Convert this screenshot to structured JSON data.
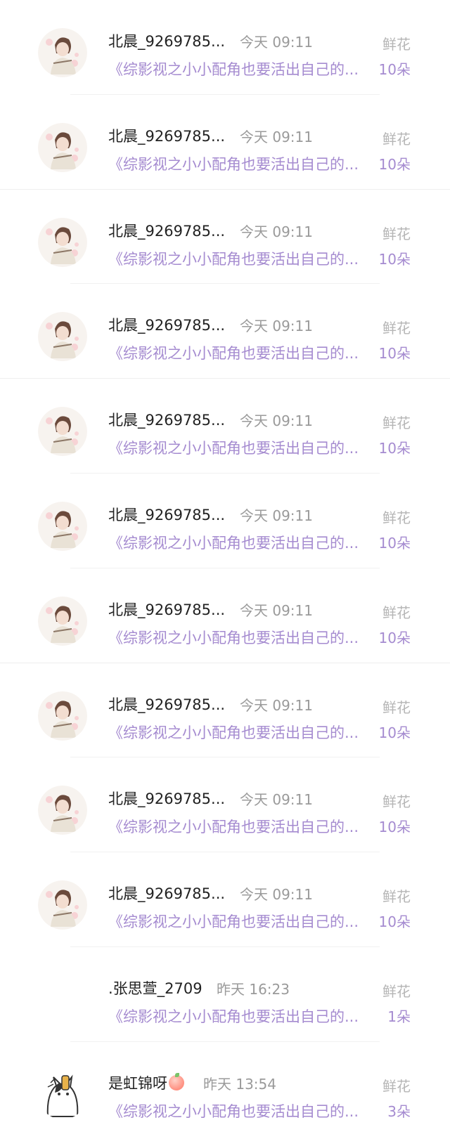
{
  "rows": [
    {
      "name": "北晨_9269785...",
      "time": "今天 09:11",
      "gift": "鲜花",
      "book": "《综影视之小小配角也要活出自己的...",
      "count": "10朵",
      "avatar": "girl-avatar"
    },
    {
      "name": "北晨_9269785...",
      "time": "今天 09:11",
      "gift": "鲜花",
      "book": "《综影视之小小配角也要活出自己的...",
      "count": "10朵",
      "avatar": "girl-avatar"
    },
    {
      "name": "北晨_9269785...",
      "time": "今天 09:11",
      "gift": "鲜花",
      "book": "《综影视之小小配角也要活出自己的...",
      "count": "10朵",
      "avatar": "girl-avatar"
    },
    {
      "name": "北晨_9269785...",
      "time": "今天 09:11",
      "gift": "鲜花",
      "book": "《综影视之小小配角也要活出自己的...",
      "count": "10朵",
      "avatar": "girl-avatar"
    },
    {
      "name": "北晨_9269785...",
      "time": "今天 09:11",
      "gift": "鲜花",
      "book": "《综影视之小小配角也要活出自己的...",
      "count": "10朵",
      "avatar": "girl-avatar"
    },
    {
      "name": "北晨_9269785...",
      "time": "今天 09:11",
      "gift": "鲜花",
      "book": "《综影视之小小配角也要活出自己的...",
      "count": "10朵",
      "avatar": "girl-avatar"
    },
    {
      "name": "北晨_9269785...",
      "time": "今天 09:11",
      "gift": "鲜花",
      "book": "《综影视之小小配角也要活出自己的...",
      "count": "10朵",
      "avatar": "girl-avatar"
    },
    {
      "name": "北晨_9269785...",
      "time": "今天 09:11",
      "gift": "鲜花",
      "book": "《综影视之小小配角也要活出自己的...",
      "count": "10朵",
      "avatar": "girl-avatar"
    },
    {
      "name": "北晨_9269785...",
      "time": "今天 09:11",
      "gift": "鲜花",
      "book": "《综影视之小小配角也要活出自己的...",
      "count": "10朵",
      "avatar": "girl-avatar"
    },
    {
      "name": "北晨_9269785...",
      "time": "今天 09:11",
      "gift": "鲜花",
      "book": "《综影视之小小配角也要活出自己的...",
      "count": "10朵",
      "avatar": "girl-avatar"
    },
    {
      "name": ".张思萱_2709",
      "time": "昨天 16:23",
      "gift": "鲜花",
      "book": "《综影视之小小配角也要活出自己的...",
      "count": "1朵",
      "avatar": "none"
    },
    {
      "name": "是虹锦呀",
      "time": "昨天 13:54",
      "gift": "鲜花",
      "book": "《综影视之小小配角也要活出自己的...",
      "count": "3朵",
      "avatar": "cat-avatar"
    }
  ],
  "colors": {
    "accent": "#a58bd0",
    "name": "#222222",
    "muted": "#9a9a9a",
    "gift": "#b5b5b5"
  }
}
